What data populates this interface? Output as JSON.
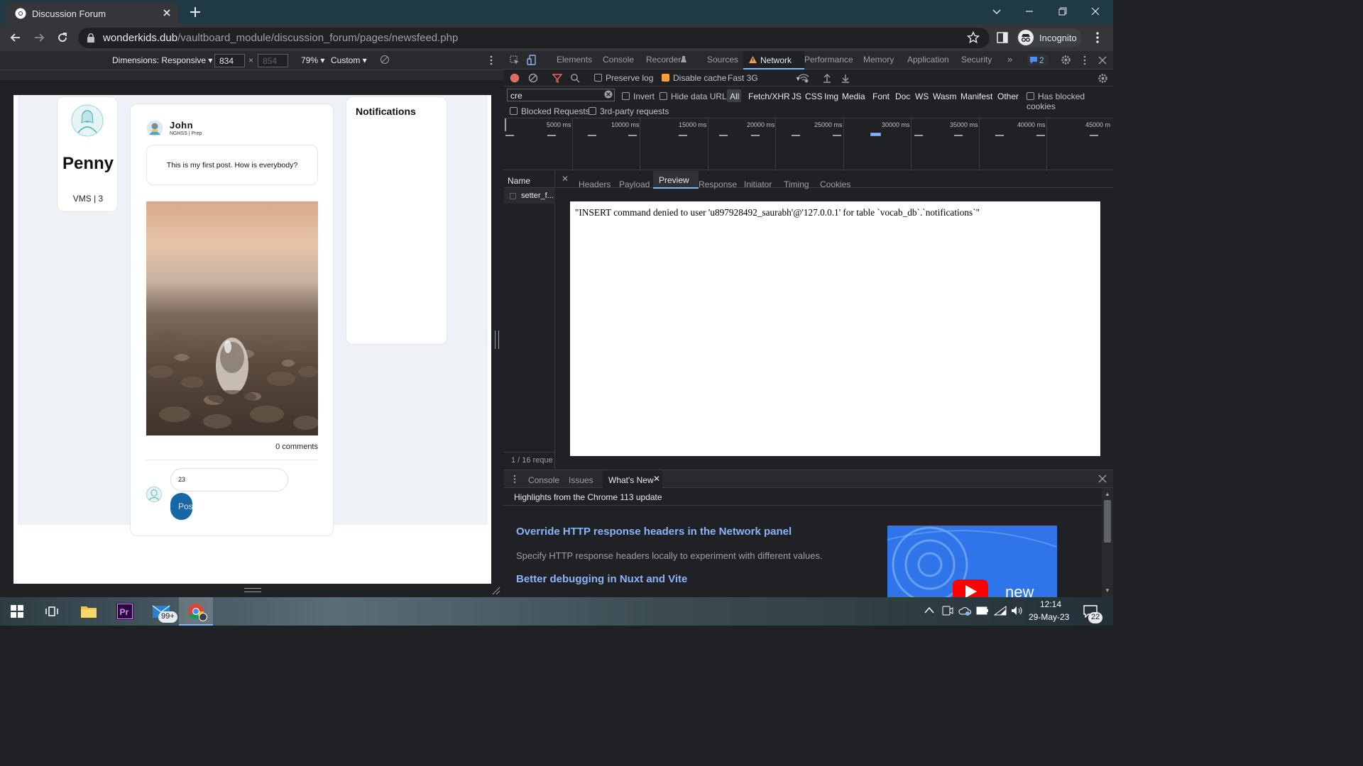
{
  "browser": {
    "tab_title": "Discussion Forum",
    "url_host": "wonderkids.dub",
    "url_path": "/vaultboard_module/discussion_forum/pages/newsfeed.php",
    "profile_label": "Incognito"
  },
  "device_toolbar": {
    "dimensions_label": "Dimensions: Responsive",
    "width_value": "834",
    "height_value": "854",
    "zoom_label": "79%",
    "throttle_label": "Custom",
    "x_sep": "×"
  },
  "forum": {
    "profile_name": "Penny",
    "profile_meta": "VMS | 3",
    "post_author": "John",
    "post_author_meta": "NGHSS | Prep",
    "post_text": "This is my first post. How is everybody?",
    "comments_count": "0 comments",
    "comment_input_value": "23",
    "post_button_label": "Pos",
    "notifications_title": "Notifications"
  },
  "devtools": {
    "tabs": [
      "Elements",
      "Console",
      "Recorder",
      "Sources",
      "Network",
      "Performance",
      "Memory",
      "Application",
      "Security"
    ],
    "active_tab": "Network",
    "issues_badge": "2",
    "preserve_log_label": "Preserve log",
    "disable_cache_label": "Disable cache",
    "throttling_value": "Fast 3G",
    "filter_value": "cre",
    "invert_label": "Invert",
    "hide_data_urls_label": "Hide data URLs",
    "filter_types": [
      "All",
      "Fetch/XHR",
      "JS",
      "CSS",
      "Img",
      "Media",
      "Font",
      "Doc",
      "WS",
      "Wasm",
      "Manifest",
      "Other"
    ],
    "has_blocked_cookies_label": "Has blocked cookies",
    "blocked_requests_label": "Blocked Requests",
    "third_party_label": "3rd-party requests",
    "timeline_labels": [
      "5000 ms",
      "10000 ms",
      "15000 ms",
      "20000 ms",
      "25000 ms",
      "30000 ms",
      "35000 ms",
      "40000 ms",
      "45000 m"
    ],
    "name_header": "Name",
    "request_name": "setter_f...",
    "panel_tabs": [
      "Headers",
      "Payload",
      "Preview",
      "Response",
      "Initiator",
      "Timing",
      "Cookies"
    ],
    "active_panel_tab": "Preview",
    "preview_text": "\"INSERT command denied to user 'u897928492_saurabh'@'127.0.0.1' for table `vocab_db`.`notifications`\"",
    "requests_summary": "1 / 16 reque",
    "drawer_tabs": [
      "Console",
      "Issues",
      "What's New"
    ],
    "active_drawer_tab": "What's New",
    "whats_new_header": "Highlights from the Chrome 113 update",
    "article1_title": "Override HTTP response headers in the Network panel",
    "article1_desc": "Specify HTTP response headers locally to experiment with different values.",
    "article2_title": "Better debugging in Nuxt and Vite",
    "video_word": "new"
  },
  "taskbar": {
    "mail_badge": "99+",
    "time": "12:14",
    "date": "29-May-23",
    "notification_count": "22"
  },
  "colors": {
    "accent_blue": "#8ab4f8",
    "warning": "#f6a23c",
    "record_red": "#e46962",
    "post_button": "#1766a6"
  }
}
